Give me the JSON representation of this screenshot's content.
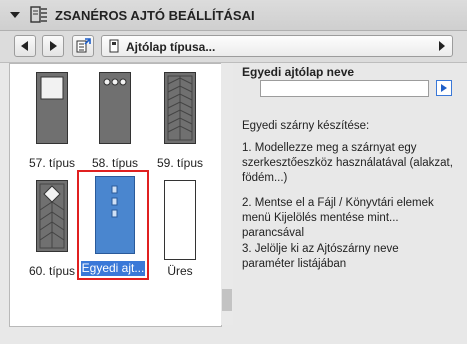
{
  "header": {
    "title": "ZSANÉROS AJTÓ BEÁLLÍTÁSAI",
    "icon": "door-settings-icon"
  },
  "toolbar": {
    "prev_icon": "prev-icon",
    "next_icon": "next-icon",
    "library_icon": "library-icon",
    "selector_label": "Ajtólap típusa...",
    "selector_icon": "door-leaf-icon"
  },
  "gallery": {
    "items": [
      {
        "label": "57. típus",
        "icon": "door-window-icon"
      },
      {
        "label": "58. típus",
        "icon": "door-three-lights-icon"
      },
      {
        "label": "59. típus",
        "icon": "door-herringbone-icon"
      },
      {
        "label": "60. típus",
        "icon": "door-diamond-icon"
      },
      {
        "label": "Egyedi ajt...",
        "icon": "door-custom-icon",
        "selected": true
      },
      {
        "label": "Üres",
        "icon": "door-empty-icon"
      }
    ]
  },
  "details": {
    "name_label": "Egyedi ajtólap neve",
    "name_value": "",
    "heading": "Egyedi szárny készítése:",
    "step1": "1. Modellezze meg a szárnyat egy szerkesztőeszköz használatával (alakzat, födém...)",
    "step2": "2. Mentse el a Fájl / Könyvtári elemek menü Kijelölés mentése mint... parancsával",
    "step3": "3. Jelölje ki az Ajtószárny neve paraméter listájában"
  },
  "colors": {
    "selection": "#3a78d8",
    "highlight_frame": "#e02020",
    "door_fill": "#707070"
  }
}
